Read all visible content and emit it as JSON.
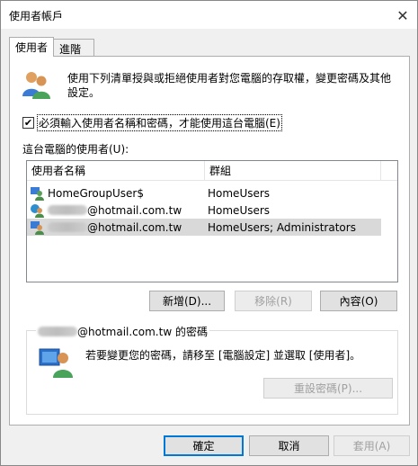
{
  "window": {
    "title": "使用者帳戶",
    "close_glyph": "✕"
  },
  "tabs": [
    {
      "label": "使用者"
    },
    {
      "label": "進階"
    }
  ],
  "description": "使用下列清單授與或拒絕使用者對您電腦的存取權，變更密碼及其他設定。",
  "require_login": {
    "checked": true,
    "label": "必須輸入使用者名稱和密碼，才能使用這台電腦(E)"
  },
  "user_list": {
    "label": "這台電腦的使用者(U):",
    "columns": [
      "使用者名稱",
      "群組"
    ],
    "rows": [
      {
        "name": "HomeGroupUser$",
        "group": "HomeUsers",
        "redacted": false,
        "selected": false
      },
      {
        "name": "@hotmail.com.tw",
        "group": "HomeUsers",
        "redacted": true,
        "selected": false
      },
      {
        "name": "@hotmail.com.tw",
        "group": "HomeUsers; Administrators",
        "redacted": true,
        "selected": true
      }
    ]
  },
  "list_buttons": {
    "add": "新增(D)...",
    "remove": "移除(R)",
    "properties": "內容(O)"
  },
  "password_group": {
    "title_suffix": "@hotmail.com.tw 的密碼",
    "text": "若要變更您的密碼，請移至 [電腦設定] 並選取 [使用者]。",
    "reset_button": "重設密碼(P)..."
  },
  "footer": {
    "ok": "確定",
    "cancel": "取消",
    "apply": "套用(A)"
  },
  "colors": {
    "accent": "#0078d7",
    "selected_row": "#d9d9d9",
    "disabled_text": "#a0a0a0"
  }
}
